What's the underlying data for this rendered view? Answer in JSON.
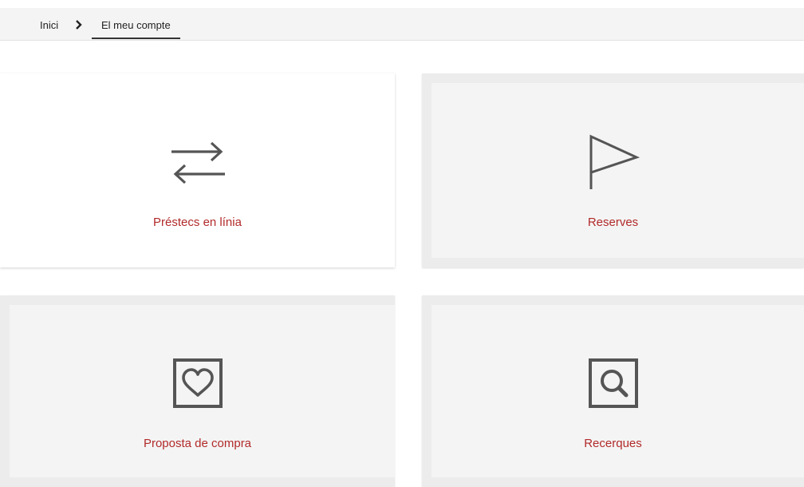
{
  "breadcrumb": {
    "home": "Inici",
    "separator_icon": "chevron-right-icon",
    "current": "El meu compte"
  },
  "cards": [
    {
      "label": "Préstecs en línia",
      "icon": "swap-arrows-icon"
    },
    {
      "label": "Reserves",
      "icon": "flag-icon"
    },
    {
      "label": "Proposta de compra",
      "icon": "heart-box-icon"
    },
    {
      "label": "Recerques",
      "icon": "search-box-icon"
    }
  ],
  "colors": {
    "accent": "#b22a2a",
    "icon": "#555555",
    "breadcrumb_bg": "#f4f4f4",
    "card_grey": "#f4f4f4"
  }
}
